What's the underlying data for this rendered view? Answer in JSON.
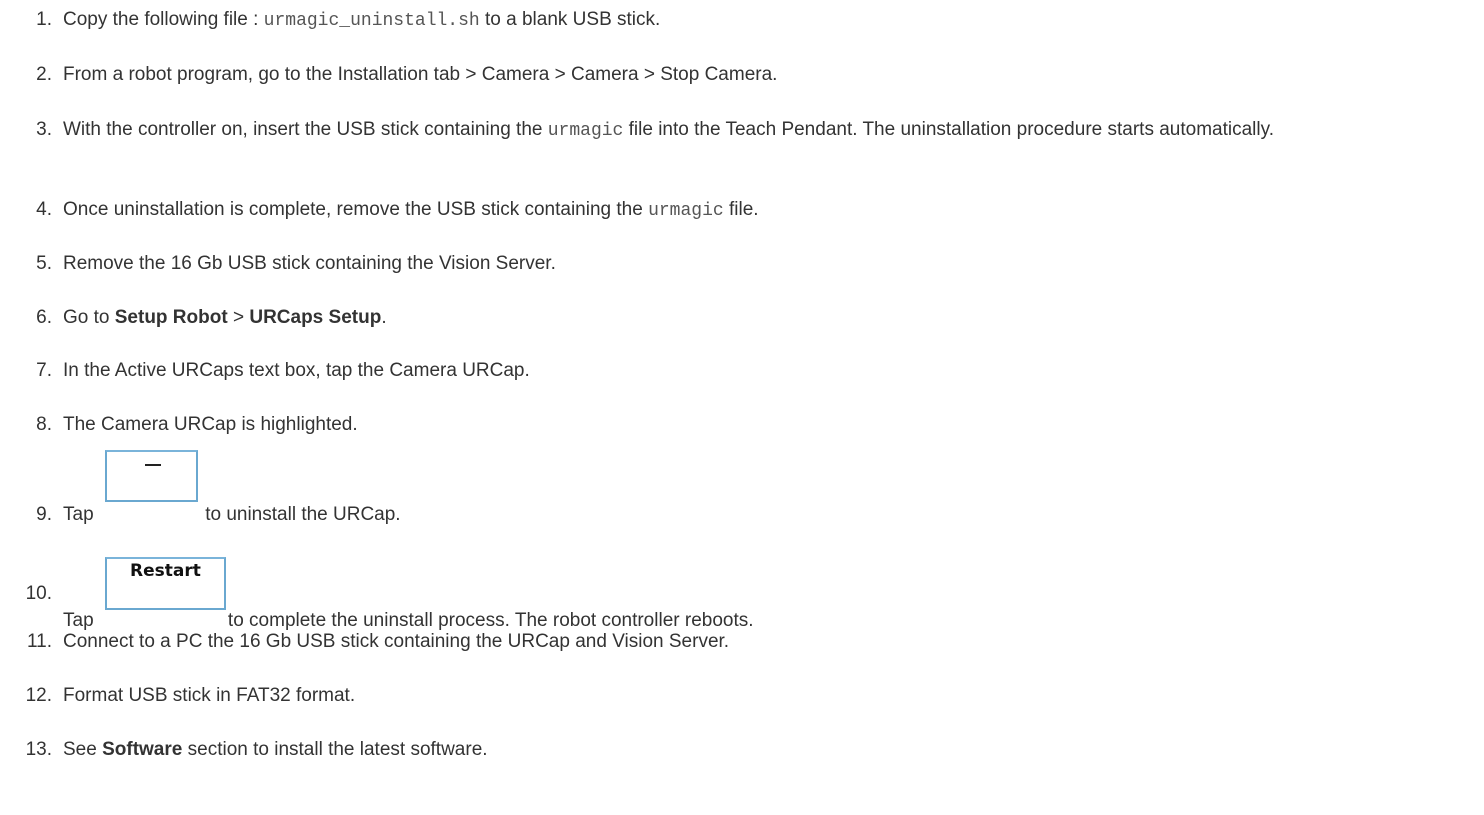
{
  "steps": [
    {
      "num": "1.",
      "pre": "Copy the following file : ",
      "code": "urmagic_uninstall.sh",
      "post": " to a blank USB stick."
    },
    {
      "num": "2.",
      "text": "From a robot program, go to the Installation tab > Camera > Camera > Stop Camera."
    },
    {
      "num": "3.",
      "pre": "With the controller on, insert the USB stick containing the ",
      "code": "urmagic",
      "post": " file into the Teach Pendant. The uninstallation procedure starts automatically."
    },
    {
      "num": "4.",
      "pre": "Once uninstallation is complete, remove the USB stick containing the ",
      "code": "urmagic",
      "post": " file."
    },
    {
      "num": "5.",
      "text": "Remove the 16 Gb USB stick containing the Vision Server."
    },
    {
      "num": "6.",
      "pre": "Go to ",
      "bold1": "Setup Robot",
      "mid": " > ",
      "bold2": "URCaps Setup",
      "post": "."
    },
    {
      "num": "7.",
      "text": "In the Active URCaps text box, tap the Camera URCap."
    },
    {
      "num": "8.",
      "text": "The Camera URCap is highlighted."
    },
    {
      "num": "9.",
      "pre": "Tap ",
      "button_icon": "minus-icon",
      "post": " to uninstall the URCap."
    },
    {
      "num": "10.",
      "pre": "Tap ",
      "button_label": "Restart",
      "post": "to complete the uninstall process. The robot controller reboots."
    },
    {
      "num": "11.",
      "text": "Connect to a PC the 16 Gb USB stick containing the URCap and Vision Server."
    },
    {
      "num": "12.",
      "text": "Format USB stick in FAT32 format."
    },
    {
      "num": "13.",
      "bold1": "Software",
      "pre": "See ",
      "post": " section to install the latest software."
    }
  ]
}
